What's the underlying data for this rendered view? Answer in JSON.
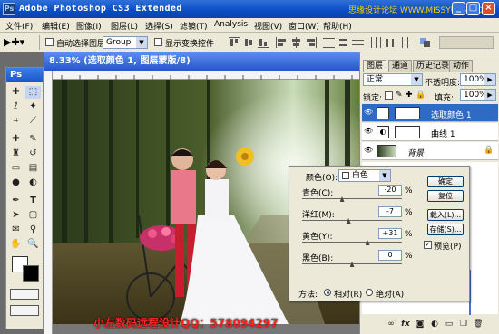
{
  "app": {
    "title": "Adobe Photoshop CS3 Extended",
    "logo_text": "Ps",
    "watermark_top": "思缘设计论坛 WWW.MISSYUAN.COM"
  },
  "menu": [
    "文件(F)",
    "编辑(E)",
    "图像(I)",
    "图层(L)",
    "选择(S)",
    "滤镜(T)",
    "Analysis",
    "视图(V)",
    "窗口(W)",
    "帮助(H)"
  ],
  "options": {
    "auto_select_label": "自动选择图层",
    "auto_select_value": "Group",
    "show_transform_label": "显示变换控件"
  },
  "toolbox": {
    "title": "Ps"
  },
  "document": {
    "title": "8.33% (选取颜色 1, 图层蒙版/8)"
  },
  "panel": {
    "tabs": [
      "图层",
      "通道",
      "历史记录",
      "动作"
    ],
    "blend_mode": "正常",
    "opacity_label": "不透明度:",
    "opacity_value": "100%",
    "lock_label": "锁定:",
    "fill_label": "填充:",
    "fill_value": "100%",
    "layers": [
      {
        "name": "选取颜色 1",
        "selected": true
      },
      {
        "name": "曲线 1",
        "selected": false
      },
      {
        "name": "背景",
        "selected": false
      }
    ]
  },
  "dialog": {
    "colors_label": "颜色(O):",
    "colors_value": "白色",
    "sliders": [
      {
        "label": "青色(C):",
        "value": "-20",
        "unit": "%",
        "fraction": 0.4
      },
      {
        "label": "洋红(M):",
        "value": "-7",
        "unit": "%",
        "fraction": 0.465
      },
      {
        "label": "黄色(Y):",
        "value": "+31",
        "unit": "%",
        "fraction": 0.655
      },
      {
        "label": "黑色(B):",
        "value": "0",
        "unit": "%",
        "fraction": 0.5
      }
    ],
    "buttons": {
      "ok": "确定",
      "reset": "复位",
      "load": "载入(L)...",
      "save": "存储(S)...",
      "preview": "预览(P)"
    },
    "method_label": "方法:",
    "method_relative": "相对(R)",
    "method_absolute": "绝对(A)"
  },
  "footer_watermark": "小左数码远程设计QQ：578094297",
  "colors": {
    "title_blue": "#0a4cc4",
    "panel_bg": "#ece9d8",
    "selection": "#316ac5",
    "watermark_red": "#ff2020"
  }
}
